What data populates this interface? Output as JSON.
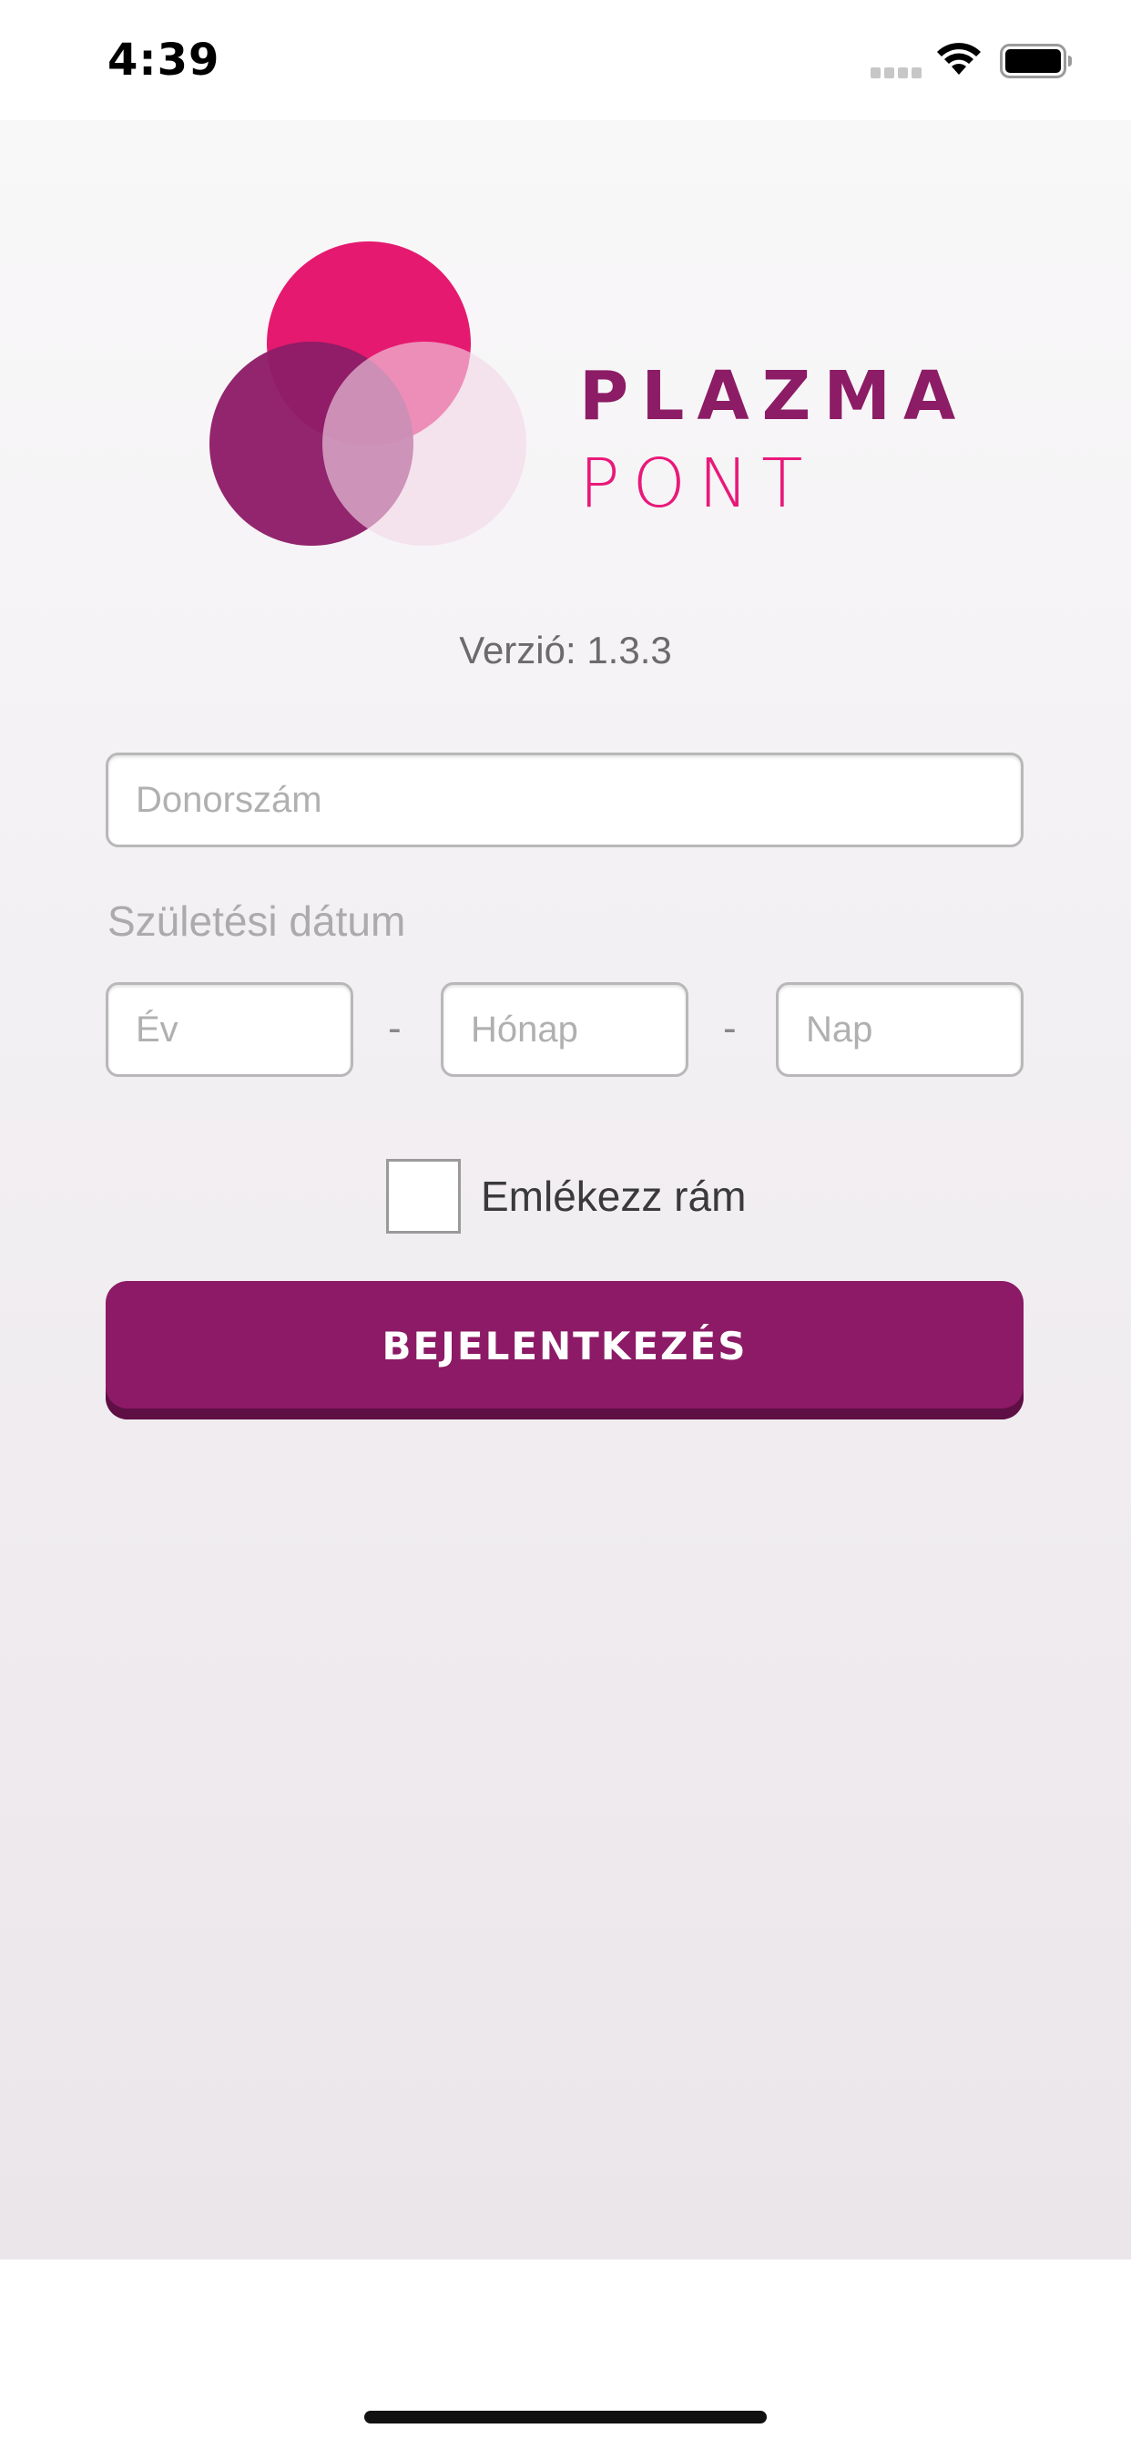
{
  "status_bar": {
    "time": "4:39"
  },
  "logo": {
    "line1": "PLAZMA",
    "line2": "PONT",
    "colors": {
      "brand_purple": "#8c1c66",
      "brand_pink": "#e8197a",
      "circle_top": "#e5196f",
      "circle_left": "#8e1c67",
      "circle_right": "#f5e3ed"
    }
  },
  "version": {
    "text": "Verzió: 1.3.3"
  },
  "form": {
    "donor_number": {
      "value": "",
      "placeholder": "Donorszám"
    },
    "dob_label": "Születési dátum",
    "year": {
      "value": "",
      "placeholder": "Év"
    },
    "month": {
      "value": "",
      "placeholder": "Hónap"
    },
    "day": {
      "value": "",
      "placeholder": "Nap"
    },
    "separator": "-",
    "remember_me": {
      "label": "Emlékezz rám",
      "checked": false
    },
    "login_button": "BEJELENTKEZÉS"
  }
}
